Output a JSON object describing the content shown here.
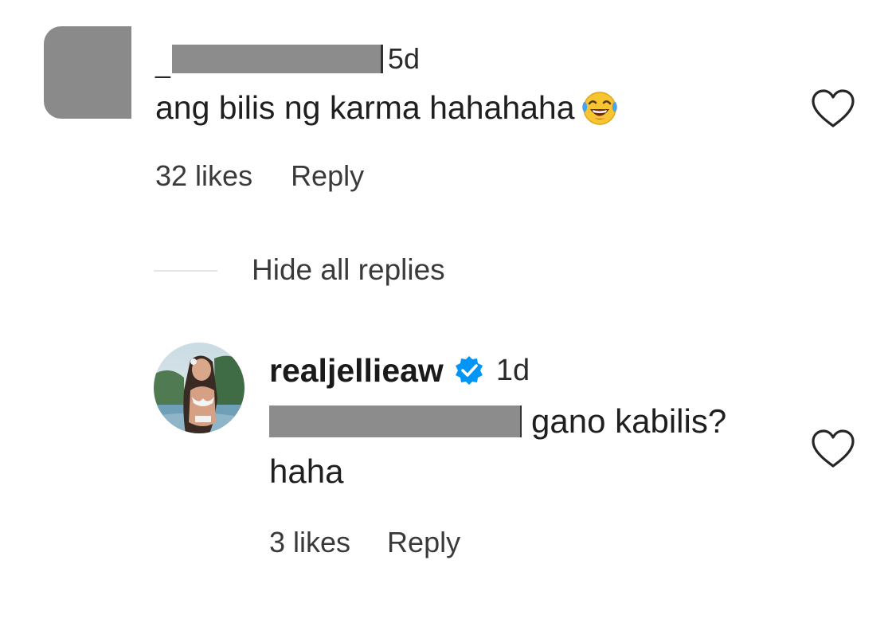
{
  "comment": {
    "username_visible_prefix": "_",
    "timestamp": "5d",
    "text": "ang bilis ng karma hahahaha",
    "emoji": "face-with-tears-of-joy",
    "likes": "32 likes",
    "reply_label": "Reply"
  },
  "thread": {
    "hide_replies_label": "Hide all replies"
  },
  "reply": {
    "username": "realjellieaw",
    "verified": true,
    "timestamp": "1d",
    "text_after_mention": "gano kabilis?",
    "text_line2": "haha",
    "likes": "3 likes",
    "reply_label": "Reply"
  },
  "colors": {
    "verified_blue": "#0095f6",
    "redaction_gray": "#8c8c8c",
    "text": "#1f1f1f",
    "secondary_text": "#3a3a3a"
  },
  "icons": {
    "like": "heart-outline-icon",
    "verified": "verified-badge-icon"
  }
}
